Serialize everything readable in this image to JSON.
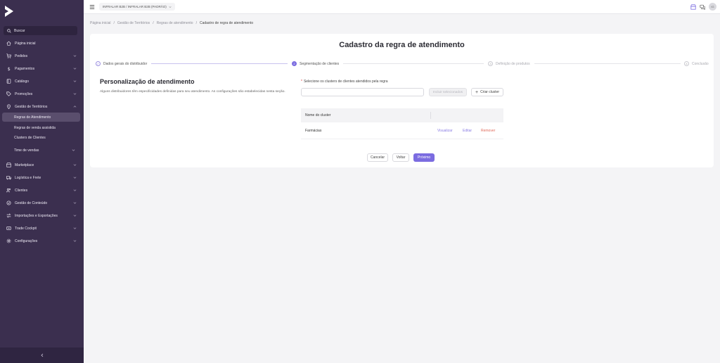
{
  "sidebar": {
    "search_label": "Buscar",
    "items": [
      {
        "label": "Página inicial",
        "icon": "home-icon",
        "chevron": false
      },
      {
        "label": "Pedidos",
        "icon": "cart-icon",
        "chevron": true
      },
      {
        "label": "Pagamentos",
        "icon": "dollar-icon",
        "chevron": true
      },
      {
        "label": "Catálogo",
        "icon": "book-icon",
        "chevron": true
      },
      {
        "label": "Promoções",
        "icon": "tag-icon",
        "chevron": true
      },
      {
        "label": "Gestão de Territórios",
        "icon": "map-pin-icon",
        "chevron": true
      },
      {
        "label": "Time de vendas",
        "icon": "",
        "chevron": true
      },
      {
        "label": "Marketplace",
        "icon": "store-icon",
        "chevron": true
      },
      {
        "label": "Logística e Frete",
        "icon": "truck-icon",
        "chevron": true
      },
      {
        "label": "Clientes",
        "icon": "users-icon",
        "chevron": true
      },
      {
        "label": "Gestão de Conteúdo",
        "icon": "content-icon",
        "chevron": true
      },
      {
        "label": "Importações e Exportações",
        "icon": "transfer-icon",
        "chevron": true
      },
      {
        "label": "Trade Cockpit",
        "icon": "cockpit-icon",
        "chevron": true
      },
      {
        "label": "Configurações",
        "icon": "gear-icon",
        "chevron": true
      }
    ],
    "sub_items": [
      {
        "label": "Regras de Atendimento",
        "active": true
      },
      {
        "label": "Regras de venda assistida",
        "active": false
      },
      {
        "label": "Clusters de Clientes",
        "active": false
      }
    ],
    "colors": {
      "background": "#3b2f4f",
      "active": "#5a4e6d"
    }
  },
  "topbar": {
    "tenant": "INFRALAR B2B / INFRALAR B2B (PADRÃO)",
    "avatar_initials": "IG"
  },
  "breadcrumb": [
    "Página inicial",
    "Gestão de Territórios",
    "Regras de atendimento",
    "Cadastro de regra de atendimento"
  ],
  "page": {
    "title": "Cadastro da regra de atendimento",
    "steps": [
      {
        "label": "Dados gerais do distribuidor",
        "marker": "✓",
        "state": "done"
      },
      {
        "label": "Segmentação de clientes",
        "marker": "2",
        "state": "current"
      },
      {
        "label": "Definição de produtos",
        "marker": "3",
        "state": "pending"
      },
      {
        "label": "Conclusão",
        "marker": "4",
        "state": "pending"
      }
    ],
    "section_title": "Personalização de atendimento",
    "section_desc": "Alguns distribuidores têm especificidades definidas para seu atendimento. As configurações são estabelecidas nesta seção.",
    "cluster_label": "Selecione os clusters de clientes atendidos pela regra",
    "cluster_input_value": "",
    "add_selected_label": "Incluir selecionados",
    "create_cluster_label": "Criar cluster",
    "table_header": "Nome do cluster",
    "rows": [
      {
        "name": "Farmácias",
        "view": "Visualizar",
        "edit": "Editar",
        "remove": "Remover"
      }
    ],
    "cancel_label": "Cancelar",
    "back_label": "Voltar",
    "next_label": "Próximo",
    "accent": "#7b6ce0"
  }
}
